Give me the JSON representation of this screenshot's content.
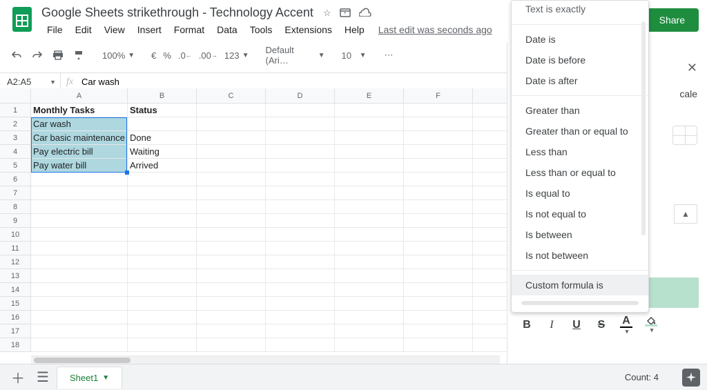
{
  "header": {
    "title": "Google Sheets strikethrough - Technology Accent",
    "last_edit": "Last edit was seconds ago"
  },
  "menus": [
    "File",
    "Edit",
    "View",
    "Insert",
    "Format",
    "Data",
    "Tools",
    "Extensions",
    "Help"
  ],
  "share_label": "Share",
  "toolbar": {
    "zoom": "100%",
    "currency": "€",
    "percent": "%",
    "dec_dec": ".0",
    "inc_dec": ".00",
    "numfmt": "123",
    "font": "Default (Ari…",
    "size": "10"
  },
  "fxbar": {
    "name": "A2:A5",
    "formula": "Car wash"
  },
  "columns": [
    "A",
    "B",
    "C",
    "D",
    "E",
    "F"
  ],
  "rows": [
    {
      "A": "Monthly Tasks",
      "B": "Status",
      "bold": true
    },
    {
      "A": "Car wash",
      "B": ""
    },
    {
      "A": "Car basic maintenance",
      "B": "Done"
    },
    {
      "A": "Pay electric bill",
      "B": "Waiting"
    },
    {
      "A": "Pay water bill",
      "B": "Arrived"
    }
  ],
  "dropdown": {
    "cutoff": "Text is exactly",
    "groups": [
      [
        "Date is",
        "Date is before",
        "Date is after"
      ],
      [
        "Greater than",
        "Greater than or equal to",
        "Less than",
        "Less than or equal to",
        "Is equal to",
        "Is not equal to",
        "Is between",
        "Is not between"
      ],
      [
        "Custom formula is"
      ]
    ],
    "selected": "Custom formula is"
  },
  "sidebar": {
    "scale": "cale"
  },
  "tabs": {
    "sheet": "Sheet1",
    "count_label": "Count: 4"
  }
}
